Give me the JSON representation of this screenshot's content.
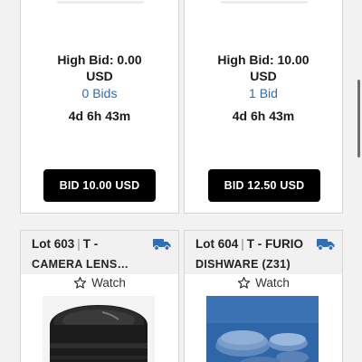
{
  "colors": {
    "accent_blue": "#2b6cb0",
    "truck_blue": "#2f6fb5",
    "button_bg": "#000000"
  },
  "cards_top": [
    {
      "high_bid": "High Bid: 0.00",
      "currency": "USD",
      "bids": "0 Bids",
      "time_left": "4d 6h 43m",
      "bid_button": "BID 10.00 USD"
    },
    {
      "high_bid": "High Bid: 10.00",
      "currency": "USD",
      "bids": "1 Bid",
      "time_left": "4d 6h 43m",
      "bid_button": "BID 12.50 USD"
    }
  ],
  "cards_bottom": [
    {
      "lot_label": "Lot 603",
      "separator": "|",
      "category": "T -",
      "title": "CAMERA LENS…",
      "watch": "Watch",
      "shipping_icon": "truck-icon",
      "image": "camera-lens-photo"
    },
    {
      "lot_label": "Lot 604",
      "separator": "|",
      "category": "T - FURIO",
      "title": "DISHWARE (Z31)",
      "watch": "Watch",
      "shipping_icon": "truck-icon",
      "image": "dishware-photo"
    }
  ]
}
